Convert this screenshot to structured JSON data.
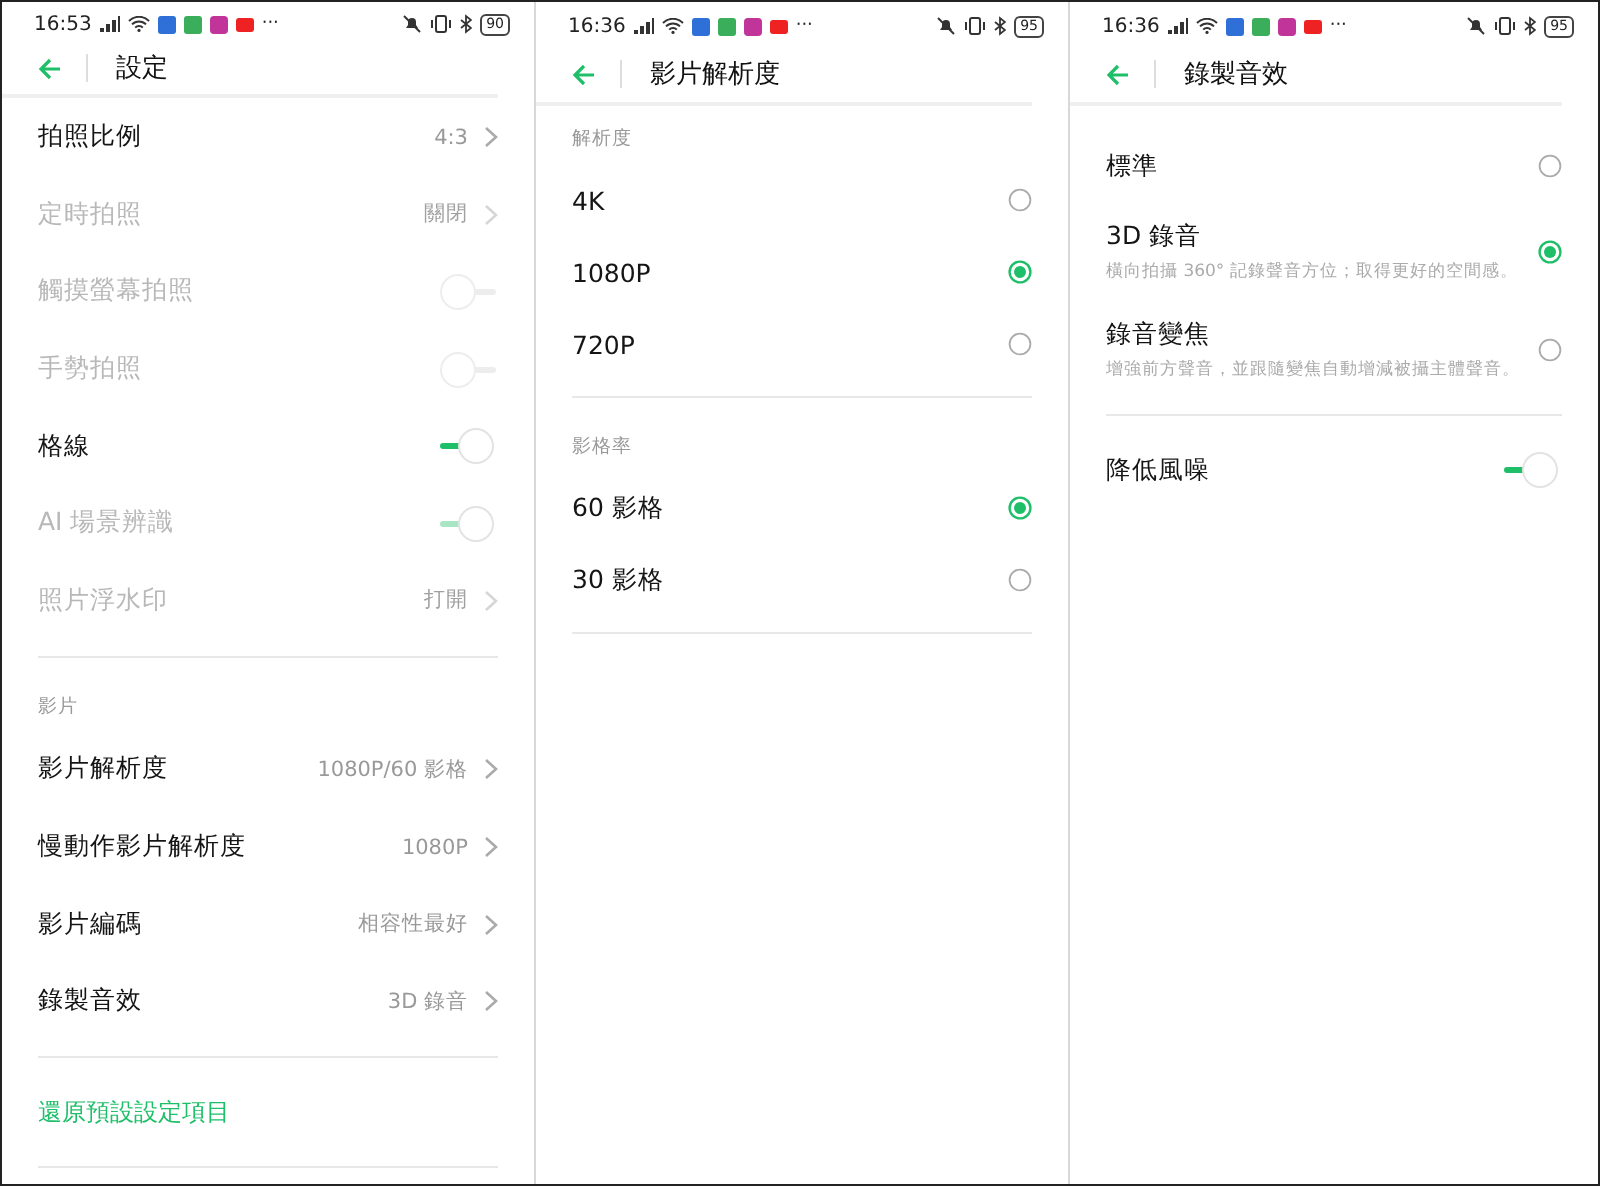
{
  "panels": [
    {
      "status": {
        "time": "16:53",
        "more": "···",
        "battery": "90"
      },
      "title": "設定",
      "items": [
        {
          "kind": "nav",
          "label": "拍照比例",
          "value": "4:3",
          "disabled": false
        },
        {
          "kind": "nav",
          "label": "定時拍照",
          "value": "關閉",
          "disabled": true
        },
        {
          "kind": "toggle",
          "label": "觸摸螢幕拍照",
          "on": false,
          "disabled": true
        },
        {
          "kind": "toggle",
          "label": "手勢拍照",
          "on": false,
          "disabled": true
        },
        {
          "kind": "toggle",
          "label": "格線",
          "on": true,
          "disabled": false
        },
        {
          "kind": "toggle",
          "label": "AI 場景辨識",
          "on": true,
          "disabled": true
        },
        {
          "kind": "nav",
          "label": "照片浮水印",
          "value": "打開",
          "disabled": true
        },
        {
          "kind": "divider"
        },
        {
          "kind": "section",
          "label": "影片"
        },
        {
          "kind": "nav",
          "label": "影片解析度",
          "value": "1080P/60 影格",
          "disabled": false
        },
        {
          "kind": "nav",
          "label": "慢動作影片解析度",
          "value": "1080P",
          "disabled": false
        },
        {
          "kind": "nav",
          "label": "影片編碼",
          "value": "相容性最好",
          "disabled": false
        },
        {
          "kind": "nav",
          "label": "錄製音效",
          "value": "3D 錄音",
          "disabled": false
        },
        {
          "kind": "divider"
        },
        {
          "kind": "link",
          "label": "還原預設設定項目"
        },
        {
          "kind": "divider"
        }
      ]
    },
    {
      "status": {
        "time": "16:36",
        "more": "···",
        "battery": "95"
      },
      "title": "影片解析度",
      "items": [
        {
          "kind": "section",
          "label": "解析度"
        },
        {
          "kind": "radio",
          "label": "4K",
          "selected": false
        },
        {
          "kind": "radio",
          "label": "1080P",
          "selected": true
        },
        {
          "kind": "radio",
          "label": "720P",
          "selected": false
        },
        {
          "kind": "divider"
        },
        {
          "kind": "section",
          "label": "影格率"
        },
        {
          "kind": "radio",
          "label": "60 影格",
          "selected": true
        },
        {
          "kind": "radio",
          "label": "30 影格",
          "selected": false
        },
        {
          "kind": "divider"
        }
      ]
    },
    {
      "status": {
        "time": "16:36",
        "more": "···",
        "battery": "95"
      },
      "title": "錄製音效",
      "items": [
        {
          "kind": "radio",
          "label": "標準",
          "selected": false
        },
        {
          "kind": "radio",
          "label": "3D 錄音",
          "description": "橫向拍攝 360° 記錄聲音方位；取得更好的空間感。",
          "selected": true
        },
        {
          "kind": "radio",
          "label": "錄音變焦",
          "description": "增強前方聲音，並跟隨變焦自動增減被攝主體聲音。",
          "selected": false
        },
        {
          "kind": "divider"
        },
        {
          "kind": "toggle",
          "label": "降低風噪",
          "on": true,
          "disabled": false
        }
      ]
    }
  ]
}
